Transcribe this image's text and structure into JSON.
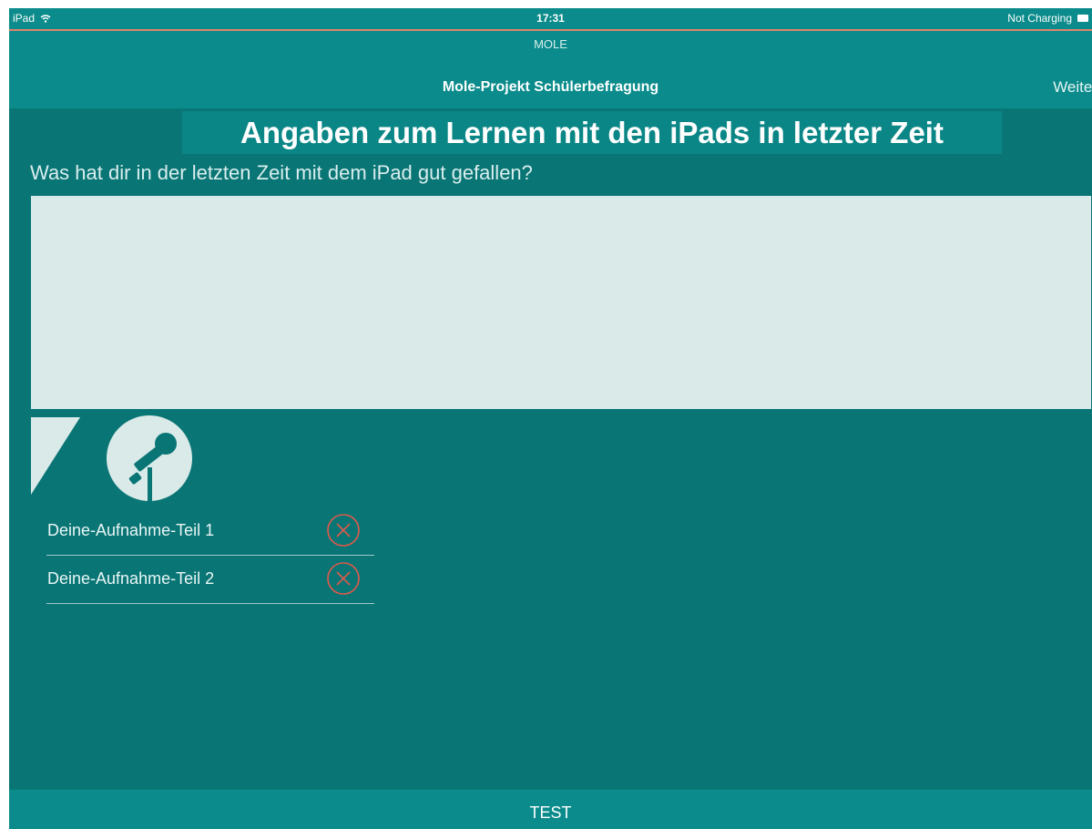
{
  "status_bar": {
    "device": "iPad",
    "time": "17:31",
    "charging": "Not Charging"
  },
  "app": {
    "label": "MOLE"
  },
  "nav": {
    "title": "Mole-Projekt Schülerbefragung",
    "next": "Weiter"
  },
  "page": {
    "heading": "Angaben zum Lernen mit den iPads in letzter Zeit",
    "question": "Was hat dir in der letzten Zeit mit dem iPad gut gefallen?",
    "answer_value": ""
  },
  "recordings": [
    {
      "label": "Deine-Aufnahme-Teil 1"
    },
    {
      "label": "Deine-Aufnahme-Teil 2"
    }
  ],
  "bottom": {
    "button": "TEST"
  },
  "icons": {
    "mic": "microphone-icon",
    "delete": "delete-circle-x-icon",
    "triangle": "collapse-triangle-icon"
  },
  "colors": {
    "background": "#0a7575",
    "bar": "#0b8b8b",
    "input": "#d9eae9",
    "delete": "#e05a4a",
    "status_line": "#e0836c"
  }
}
